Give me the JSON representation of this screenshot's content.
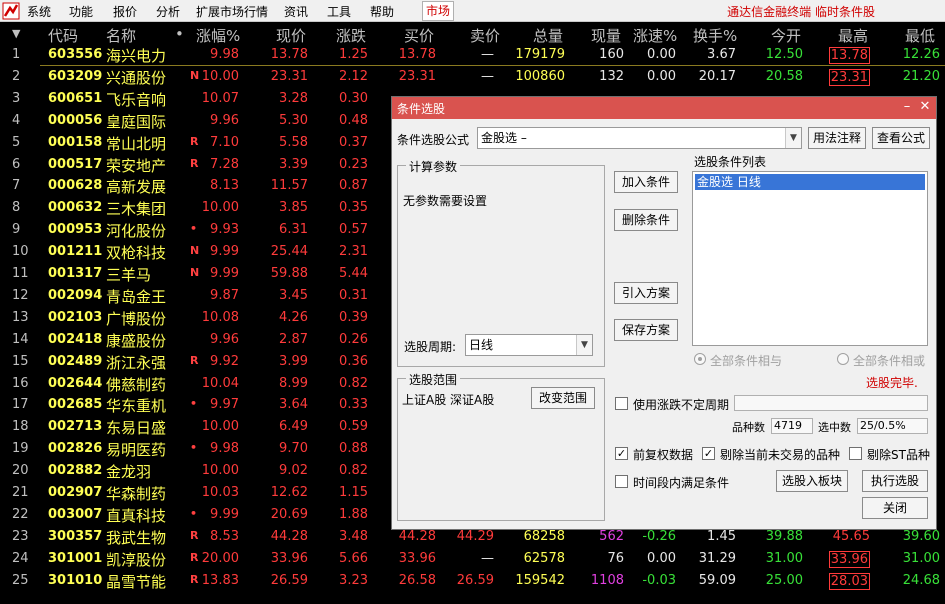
{
  "menubar": {
    "items": [
      "系统",
      "功能",
      "报价",
      "分析",
      "扩展市场行情",
      "资讯",
      "工具",
      "帮助"
    ],
    "active_tab": "市场",
    "brand": "通达信金融终端  临时条件股"
  },
  "table": {
    "headers": [
      "代码",
      "名称",
      "•",
      "涨幅%",
      "现价",
      "涨跌",
      "买价",
      "卖价",
      "总量",
      "现量",
      "涨速%",
      "换手%",
      "今开",
      "最高",
      "最低"
    ],
    "rows": [
      {
        "i": "1",
        "code": "603556",
        "name": "海兴电力",
        "flag": "",
        "pct": "9.98",
        "price": "13.78",
        "chg": "1.25",
        "bid": "13.78",
        "ask": "—",
        "vol": "179179",
        "cur": "160",
        "speed": "0.00",
        "turn": "3.67",
        "open": "12.50",
        "high": "13.78",
        "low": "12.26"
      },
      {
        "i": "2",
        "code": "603209",
        "name": "兴通股份",
        "flag": "N",
        "pct": "10.00",
        "price": "23.31",
        "chg": "2.12",
        "bid": "23.31",
        "ask": "—",
        "vol": "100860",
        "cur": "132",
        "speed": "0.00",
        "turn": "20.17",
        "open": "20.58",
        "high": "23.31",
        "low": "21.20"
      },
      {
        "i": "3",
        "code": "600651",
        "name": "飞乐音响",
        "flag": "",
        "pct": "10.07",
        "price": "3.28",
        "chg": "0.30"
      },
      {
        "i": "4",
        "code": "000056",
        "name": "皇庭国际",
        "flag": "",
        "pct": "9.96",
        "price": "5.30",
        "chg": "0.48"
      },
      {
        "i": "5",
        "code": "000158",
        "name": "常山北明",
        "flag": "R",
        "pct": "7.10",
        "price": "5.58",
        "chg": "0.37"
      },
      {
        "i": "6",
        "code": "000517",
        "name": "荣安地产",
        "flag": "R",
        "pct": "7.28",
        "price": "3.39",
        "chg": "0.23"
      },
      {
        "i": "7",
        "code": "000628",
        "name": "高新发展",
        "flag": "",
        "pct": "8.13",
        "price": "11.57",
        "chg": "0.87"
      },
      {
        "i": "8",
        "code": "000632",
        "name": "三木集团",
        "flag": "",
        "pct": "10.00",
        "price": "3.85",
        "chg": "0.35"
      },
      {
        "i": "9",
        "code": "000953",
        "name": "河化股份",
        "flag": "•",
        "pct": "9.93",
        "price": "6.31",
        "chg": "0.57"
      },
      {
        "i": "10",
        "code": "001211",
        "name": "双枪科技",
        "flag": "N",
        "pct": "9.99",
        "price": "25.44",
        "chg": "2.31"
      },
      {
        "i": "11",
        "code": "001317",
        "name": "三羊马",
        "flag": "N",
        "pct": "9.99",
        "price": "59.88",
        "chg": "5.44"
      },
      {
        "i": "12",
        "code": "002094",
        "name": "青岛金王",
        "flag": "",
        "pct": "9.87",
        "price": "3.45",
        "chg": "0.31"
      },
      {
        "i": "13",
        "code": "002103",
        "name": "广博股份",
        "flag": "",
        "pct": "10.08",
        "price": "4.26",
        "chg": "0.39"
      },
      {
        "i": "14",
        "code": "002418",
        "name": "康盛股份",
        "flag": "",
        "pct": "9.96",
        "price": "2.87",
        "chg": "0.26"
      },
      {
        "i": "15",
        "code": "002489",
        "name": "浙江永强",
        "flag": "R",
        "pct": "9.92",
        "price": "3.99",
        "chg": "0.36"
      },
      {
        "i": "16",
        "code": "002644",
        "name": "佛慈制药",
        "flag": "",
        "pct": "10.04",
        "price": "8.99",
        "chg": "0.82"
      },
      {
        "i": "17",
        "code": "002685",
        "name": "华东重机",
        "flag": "•",
        "pct": "9.97",
        "price": "3.64",
        "chg": "0.33"
      },
      {
        "i": "18",
        "code": "002713",
        "name": "东易日盛",
        "flag": "",
        "pct": "10.00",
        "price": "6.49",
        "chg": "0.59"
      },
      {
        "i": "19",
        "code": "002826",
        "name": "易明医药",
        "flag": "•",
        "pct": "9.98",
        "price": "9.70",
        "chg": "0.88"
      },
      {
        "i": "20",
        "code": "002882",
        "name": "金龙羽",
        "flag": "",
        "pct": "10.00",
        "price": "9.02",
        "chg": "0.82"
      },
      {
        "i": "21",
        "code": "002907",
        "name": "华森制药",
        "flag": "",
        "pct": "10.03",
        "price": "12.62",
        "chg": "1.15"
      },
      {
        "i": "22",
        "code": "003007",
        "name": "直真科技",
        "flag": "•",
        "pct": "9.99",
        "price": "20.69",
        "chg": "1.88"
      },
      {
        "i": "23",
        "code": "300357",
        "name": "我武生物",
        "flag": "R",
        "pct": "8.53",
        "price": "44.28",
        "chg": "3.48",
        "bid": "44.28",
        "ask": "44.29",
        "vol": "68258",
        "cur": "562",
        "speed": "-0.26",
        "turn": "1.45",
        "open": "39.88",
        "high": "45.65",
        "low": "39.60"
      },
      {
        "i": "24",
        "code": "301001",
        "name": "凯淳股份",
        "flag": "R",
        "pct": "20.00",
        "price": "33.96",
        "chg": "5.66",
        "bid": "33.96",
        "ask": "—",
        "vol": "62578",
        "cur": "76",
        "speed": "0.00",
        "turn": "31.29",
        "open": "31.00",
        "high": "33.96",
        "low": "31.00"
      },
      {
        "i": "25",
        "code": "301010",
        "name": "晶雪节能",
        "flag": "R",
        "pct": "13.83",
        "price": "26.59",
        "chg": "3.23",
        "bid": "26.58",
        "ask": "26.59",
        "vol": "159542",
        "cur": "1108",
        "speed": "-0.03",
        "turn": "59.09",
        "open": "25.00",
        "high": "28.03",
        "low": "24.68"
      }
    ]
  },
  "dialog": {
    "title": "条件选股",
    "formula_label": "条件选股公式",
    "formula_value": "金股选          –",
    "usage_button": "用法注释",
    "view_formula_button": "查看公式",
    "params_group": "计算参数",
    "params_text": "无参数需要设置",
    "add_condition": "加入条件",
    "delete_condition": "删除条件",
    "import_plan": "引入方案",
    "save_plan": "保存方案",
    "list_title": "选股条件列表",
    "list_items": [
      "金股选    日线"
    ],
    "period_label": "选股周期:",
    "period_value": "日线",
    "radio_all_and": "全部条件相与",
    "radio_all_or": "全部条件相或",
    "status": "选股完毕.",
    "range_group": "选股范围",
    "range_text": "上证A股 深证A股",
    "change_range": "改变范围",
    "use_uncertain_period": "使用涨跌不定周期",
    "count_label": "品种数",
    "count_value": "4719",
    "hit_label": "选中数",
    "hit_value": "25/0.5%",
    "forward_adjust": "前复权数据",
    "exclude_untraded": "剔除当前未交易的品种",
    "exclude_st": "剔除ST品种",
    "time_period": "时间段内满足条件",
    "to_block": "选股入板块",
    "execute": "执行选股",
    "close": "关闭"
  },
  "colors": {
    "up": "#ff3b3b",
    "down": "#38e038",
    "code": "#ffff55",
    "title_bar": "#d9534f",
    "selection": "#3875d7"
  }
}
